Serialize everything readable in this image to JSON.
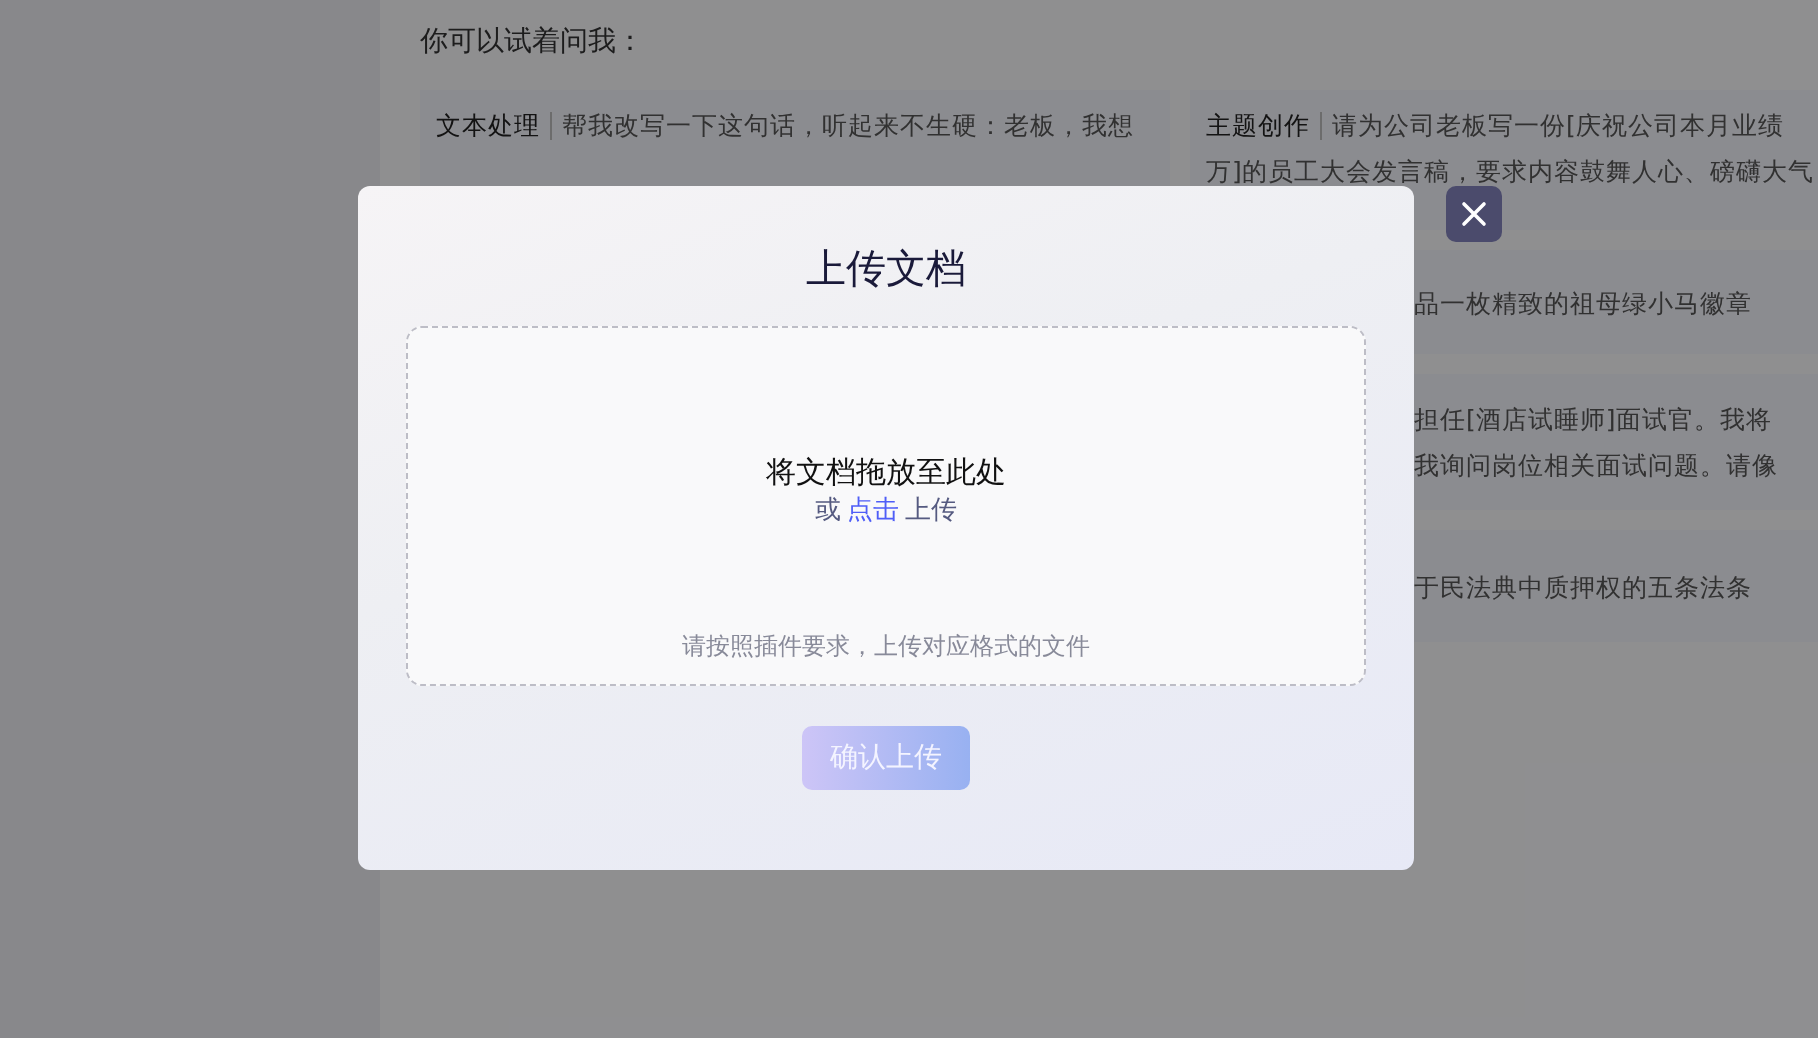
{
  "background": {
    "prompt": "你可以试着问我：",
    "left_cards": [
      {
        "label": "文本处理",
        "lines": [
          "帮我改写一下这句话，听起来不生硬：老板，我想"
        ]
      }
    ],
    "right_cards": [
      {
        "label": "主题创作",
        "lines": [
          "请为公司老板写一份[庆祝公司本月业绩",
          "万]的员工大会发言稿，要求内容鼓舞人心、磅礴大气"
        ]
      },
      {
        "lines": [
          "品一枚精致的祖母绿小马徽章"
        ]
      },
      {
        "lines": [
          "担任[酒店试睡师]面试官。我将",
          "我询问岗位相关面试问题。请像"
        ]
      },
      {
        "lines": [
          "于民法典中质押权的五条法条"
        ]
      }
    ]
  },
  "dialog": {
    "title": "上传文档",
    "dropzone": {
      "prompt": "将文档拖放至此处",
      "or_text": "或",
      "link": "点击",
      "after_text": "上传",
      "hint": "请按照插件要求，上传对应格式的文件"
    },
    "confirm_button": {
      "label": "确认上传",
      "disabled": true
    }
  }
}
